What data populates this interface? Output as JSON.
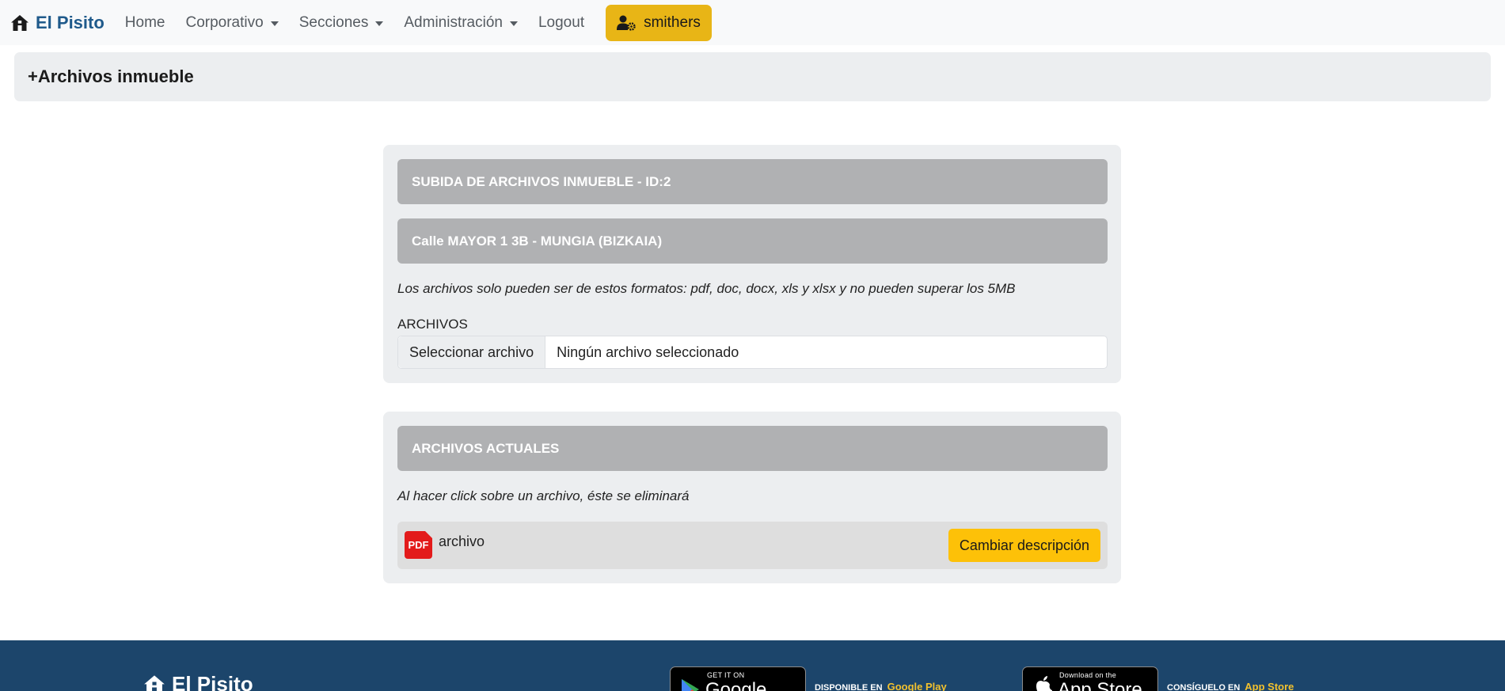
{
  "navbar": {
    "brand": "El Pisito",
    "items": [
      {
        "label": "Home",
        "dropdown": false
      },
      {
        "label": "Corporativo",
        "dropdown": true
      },
      {
        "label": "Secciones",
        "dropdown": true
      },
      {
        "label": "Administración",
        "dropdown": true
      },
      {
        "label": "Logout",
        "dropdown": false
      }
    ],
    "user": "smithers"
  },
  "page_header": {
    "title": "+Archivos inmueble"
  },
  "upload_card": {
    "title": "SUBIDA DE ARCHIVOS INMUEBLE - ID:2",
    "address": "Calle MAYOR 1 3B - MUNGIA (BIZKAIA)",
    "note": "Los archivos solo pueden ser de estos formatos: pdf, doc, docx, xls y xlsx y no pueden superar los 5MB",
    "field_label": "ARCHIVOS",
    "file_button": "Seleccionar archivo",
    "file_status": "Ningún archivo seleccionado"
  },
  "files_card": {
    "title": "ARCHIVOS ACTUALES",
    "note": "Al hacer click sobre un archivo, éste se eliminará",
    "files": [
      {
        "icon_label": "PDF",
        "name": "archivo",
        "button": "Cambiar descripción"
      }
    ]
  },
  "footer": {
    "brand": "El Pisito",
    "google": {
      "badge_small": "GET IT ON",
      "badge_large": "Google Play",
      "prefix": "DISPONIBLE EN",
      "link": "Google Play"
    },
    "apple": {
      "badge_small": "Download on the",
      "badge_large": "App Store",
      "prefix": "CONSÍGUELO EN",
      "link": "App Store"
    }
  },
  "colors": {
    "brand": "#1f5a8b",
    "user_button": "#e8b516",
    "action_button": "#fdc108",
    "card_bar": "#b0b1b3",
    "footer": "#1c456b",
    "footer_link": "#f2c12e",
    "pdf": "#e31b1b"
  }
}
